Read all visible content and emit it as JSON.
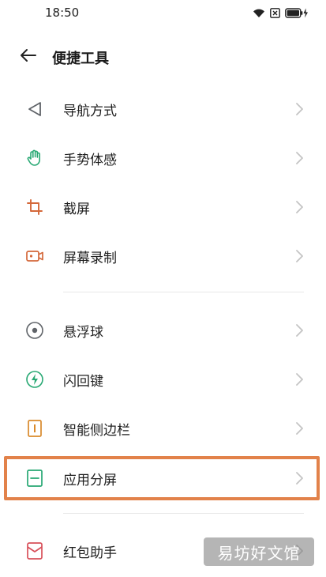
{
  "status_bar": {
    "time": "18:50",
    "icons": [
      "wifi-icon",
      "sim-off-icon",
      "battery-charging-icon"
    ]
  },
  "header": {
    "title": "便捷工具",
    "back_icon": "arrow-left-icon"
  },
  "colors": {
    "nav": "#5f6368",
    "gesture": "#27a873",
    "screenshot": "#d4683a",
    "record": "#d4683a",
    "float": "#5f6368",
    "flash": "#27a873",
    "sidebar": "#d9892a",
    "split": "#27a873",
    "redpacket": "#d8505a",
    "highlight": "#e2824a"
  },
  "groups": [
    {
      "items": [
        {
          "label": "导航方式",
          "icon": "navigation-triangle-icon"
        },
        {
          "label": "手势体感",
          "icon": "hand-gesture-icon"
        },
        {
          "label": "截屏",
          "icon": "crop-screenshot-icon"
        },
        {
          "label": "屏幕录制",
          "icon": "video-record-icon"
        }
      ]
    },
    {
      "items": [
        {
          "label": "悬浮球",
          "icon": "floating-ball-icon"
        },
        {
          "label": "闪回键",
          "icon": "lightning-icon"
        },
        {
          "label": "智能侧边栏",
          "icon": "sidebar-icon"
        },
        {
          "label": "应用分屏",
          "icon": "split-screen-icon"
        }
      ]
    },
    {
      "items": [
        {
          "label": "红包助手",
          "icon": "red-packet-icon"
        }
      ]
    }
  ],
  "watermark": "易坊好文馆"
}
